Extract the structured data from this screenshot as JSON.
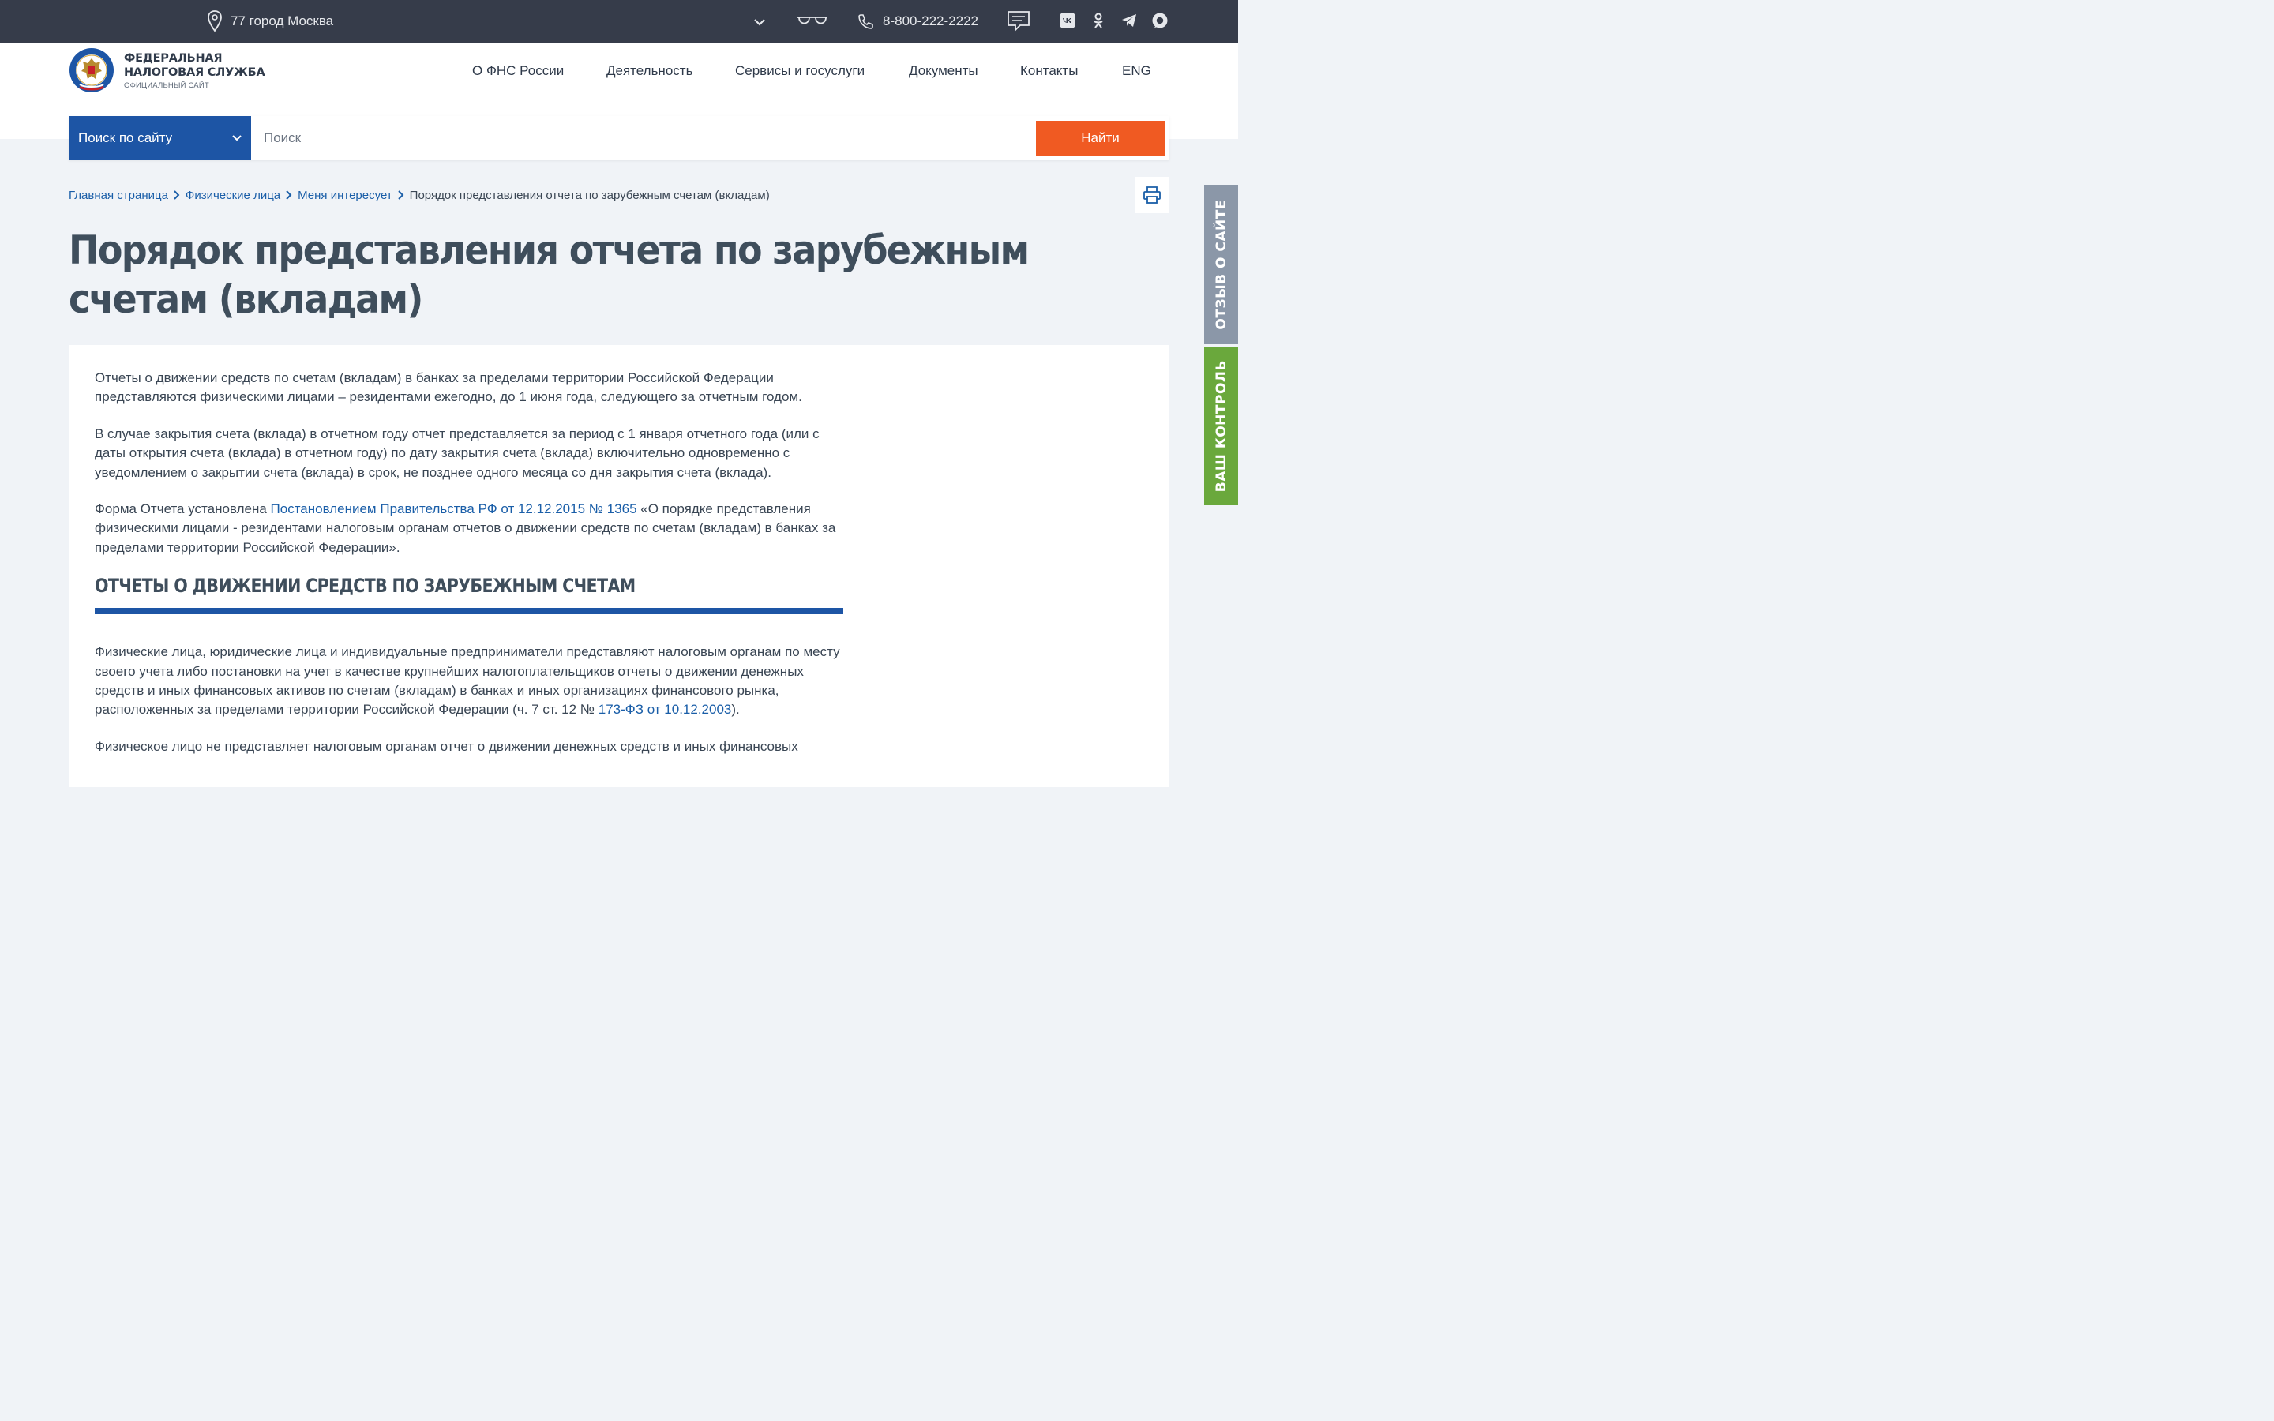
{
  "topbar": {
    "region": "77 город Москва",
    "phone": "8-800-222-2222"
  },
  "header": {
    "logo_line1": "ФЕДЕРАЛЬНАЯ",
    "logo_line2": "НАЛОГОВАЯ СЛУЖБА",
    "logo_sub": "ОФИЦИАЛЬНЫЙ САЙТ",
    "nav": [
      {
        "label": "О ФНС России"
      },
      {
        "label": "Деятельность"
      },
      {
        "label": "Сервисы и госуслуги"
      },
      {
        "label": "Документы"
      },
      {
        "label": "Контакты"
      },
      {
        "label": "ENG"
      }
    ]
  },
  "search": {
    "scope": "Поиск по сайту",
    "placeholder": "Поиск",
    "value": "",
    "button": "Найти"
  },
  "breadcrumbs": {
    "items": [
      "Главная страница",
      "Физические лица",
      "Меня интересует"
    ],
    "current": "Порядок представления отчета по зарубежным счетам (вкладам)"
  },
  "page": {
    "title": "Порядок представления отчета по зарубежным счетам (вкладам)",
    "p1": "Отчеты о движении средств по счетам (вкладам) в банках за пределами территории Российской Федерации представляются физическими лицами – резидентами ежегодно, до 1 июня года, следующего за отчетным годом.",
    "p2": "В случае закрытия счета (вклада) в отчетном году отчет представляется за период с 1 января отчетного года (или с даты открытия счета (вклада) в отчетном году) по дату закрытия счета (вклада) включительно одновременно с уведомлением о закрытии счета (вклада) в срок, не позднее одного месяца со дня закрытия счета (вклада).",
    "p3_before": "Форма Отчета установлена ",
    "p3_link": "Постановлением Правительства РФ от 12.12.2015 № 1365",
    "p3_after": " «О порядке представления физическими лицами - резидентами налоговым органам отчетов о движении средств по счетам (вкладам) в банках за пределами территории Российской Федерации».",
    "section_heading": "ОТЧЕТЫ О ДВИЖЕНИИ СРЕДСТВ ПО ЗАРУБЕЖНЫМ СЧЕТАМ",
    "p4_before": "Физические лица, юридические лица и индивидуальные предприниматели представляют налоговым органам по месту своего учета либо постановки на учет в качестве крупнейших налогоплательщиков отчеты о движении денежных средств и иных финансовых активов по счетам (вкладам) в банках и иных организациях финансового рынка, расположенных за пределами территории Российской Федерации (ч. 7 ст. 12 № ",
    "p4_link": "173-ФЗ от 10.12.2003",
    "p4_after": ").",
    "p5": "Физическое лицо не представляет налоговым органам отчет о движении денежных средств и иных финансовых"
  },
  "side_tabs": {
    "feedback": "ОТЗЫВ О САЙТЕ",
    "control": "ВАШ КОНТРОЛЬ"
  },
  "colors": {
    "topbar": "#363c4a",
    "brand_blue": "#1d55a5",
    "link": "#1a5ea8",
    "search_button": "#f05a22",
    "feedback_tab": "#8b97a8",
    "control_tab": "#6aa83c"
  },
  "icons": {
    "region": "location-pin-icon",
    "region_toggle": "chevron-down-icon",
    "accessibility": "glasses-icon",
    "phone": "phone-icon",
    "feedback": "chat-icon",
    "socials": [
      "vk-icon",
      "odnoklassniki-icon",
      "telegram-icon",
      "max-messenger-icon"
    ],
    "print": "printer-icon"
  }
}
